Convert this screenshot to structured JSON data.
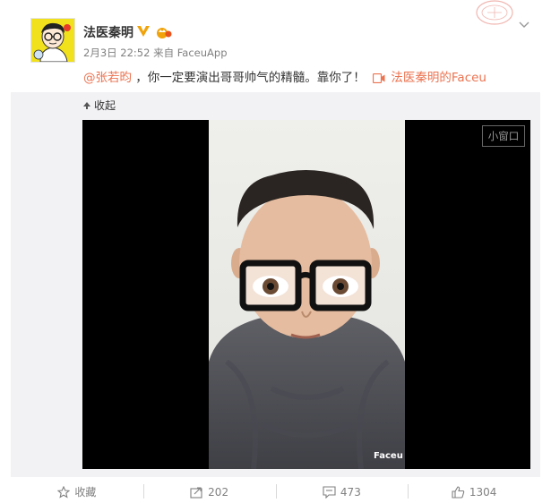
{
  "post": {
    "username": "法医秦明",
    "date": "2月3日 22:52",
    "source_prefix": "来自",
    "source": "FaceuApp",
    "mention": "@张若昀",
    "text": "，你一定要演出哥哥帅气的精髓。靠你了！",
    "video_link": "法医秦明的Faceu"
  },
  "media": {
    "collapse_label": "收起",
    "mini_window_label": "小窗口",
    "watermark": "Faceu"
  },
  "actions": {
    "favorite_label": "收藏",
    "repost_count": "202",
    "comment_count": "473",
    "like_count": "1304"
  },
  "colors": {
    "accent": "#eb7350",
    "badge_gold": "#f0a30a",
    "meta_gray": "#808080",
    "media_bg": "#f2f2f5"
  },
  "icons": [
    "verified-v-icon",
    "vip-crown-icon",
    "stamp-icon",
    "chevron-down-icon",
    "video-icon",
    "collapse-arrow-icon",
    "star-icon",
    "repost-icon",
    "comment-icon",
    "thumbs-up-icon"
  ]
}
